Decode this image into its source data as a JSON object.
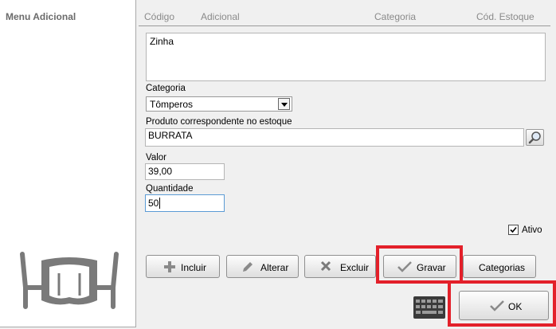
{
  "sidebar": {
    "title": "Menu Adicional"
  },
  "grid": {
    "columns": [
      "Código",
      "Adicional",
      "Categoria",
      "Cód. Estoque"
    ]
  },
  "form": {
    "description_value": "Zinha",
    "categoria_label": "Categoria",
    "categoria_value": "Tômperos",
    "produto_label": "Produto correspondente no estoque",
    "produto_value": "BURRATA",
    "valor_label": "Valor",
    "valor_value": "39,00",
    "quantidade_label": "Quantidade",
    "quantidade_value": "50",
    "ativo_label": "Ativo",
    "ativo_checked": true
  },
  "actions": {
    "incluir": "Incluir",
    "alterar": "Alterar",
    "excluir": "Excluir",
    "gravar": "Gravar",
    "categorias": "Categorias",
    "ok": "OK"
  },
  "colors": {
    "highlight": "#e3202a",
    "icon_gray": "#7a7a7a"
  },
  "icons": [
    "chair-table-icon",
    "search-icon",
    "plus-icon",
    "pencil-icon",
    "x-icon",
    "check-icon",
    "keyboard-icon"
  ]
}
